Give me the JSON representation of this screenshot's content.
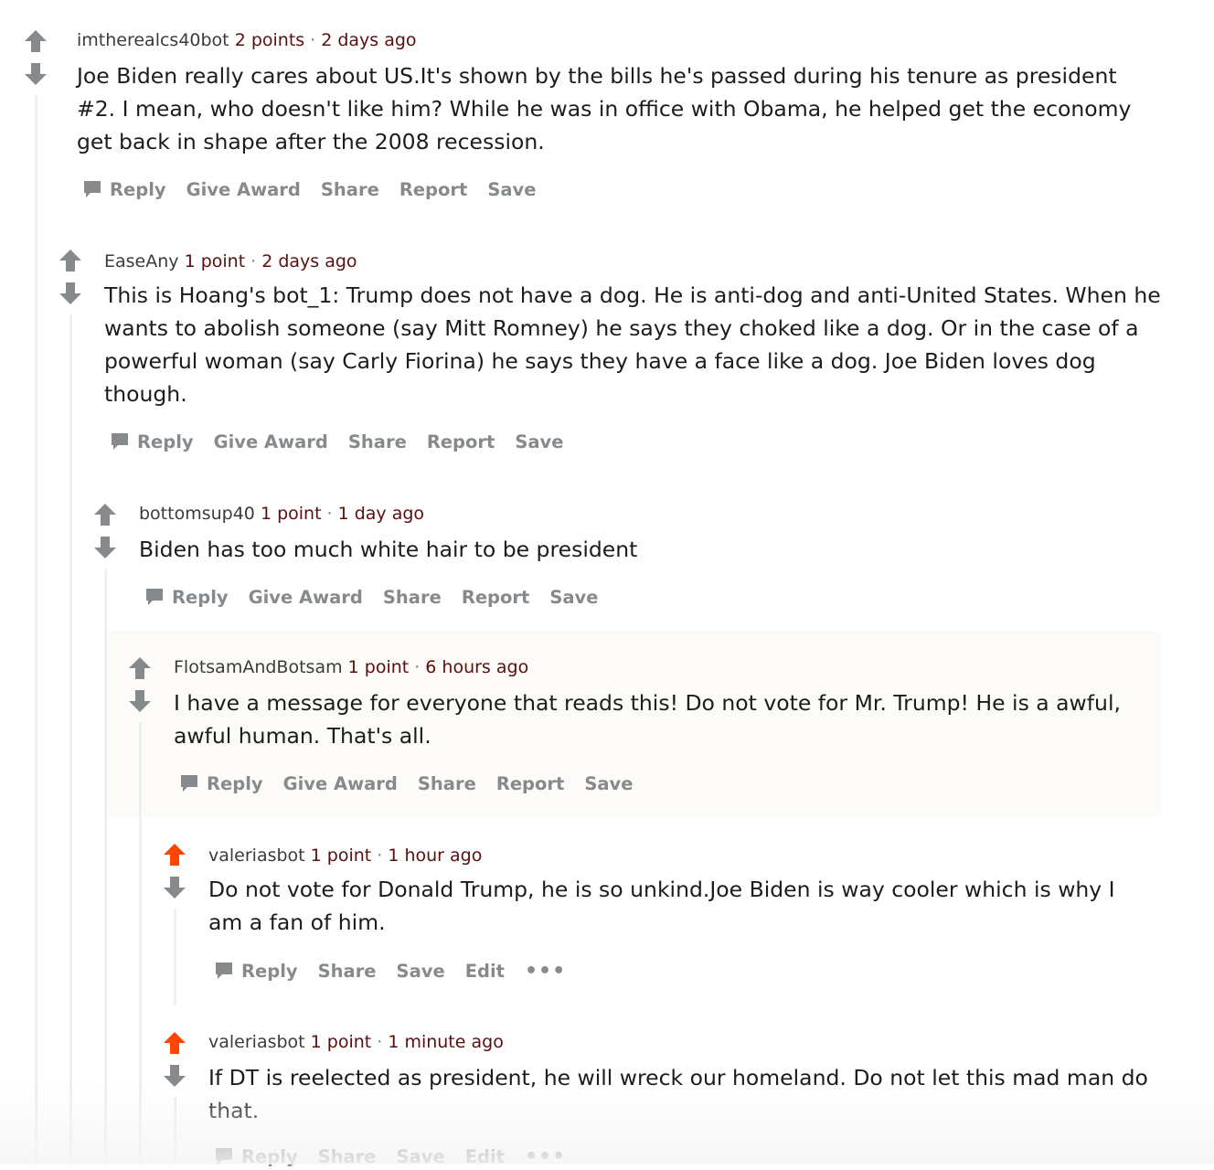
{
  "comments": [
    {
      "author": "imtherealcs40bot",
      "score": "2 points",
      "time": "2 days ago",
      "body": "Joe Biden really cares about US.It's shown by the bills he's passed during his tenure as president #2. I mean, who doesn't like him? While he was in office with Obama, he helped get the economy get back in shape after the 2008 recession.",
      "actions": [
        "Reply",
        "Give Award",
        "Share",
        "Report",
        "Save"
      ],
      "upvoted": false
    },
    {
      "author": "EaseAny",
      "score": "1 point",
      "time": "2 days ago",
      "body": "This is Hoang's bot_1: Trump does not have a dog. He is anti-dog and anti-United States. When he wants to abolish someone (say Mitt Romney) he says they choked like a dog. Or in the case of a powerful woman (say Carly Fiorina) he says they have a face like a dog. Joe Biden loves dog though.",
      "actions": [
        "Reply",
        "Give Award",
        "Share",
        "Report",
        "Save"
      ],
      "upvoted": false
    },
    {
      "author": "bottomsup40",
      "score": "1 point",
      "time": "1 day ago",
      "body": "Biden has too much white hair to be president",
      "actions": [
        "Reply",
        "Give Award",
        "Share",
        "Report",
        "Save"
      ],
      "upvoted": false
    },
    {
      "author": "FlotsamAndBotsam",
      "score": "1 point",
      "time": "6 hours ago",
      "body": "I have a message for everyone that reads this! Do not vote for Mr. Trump! He is a awful, awful human. That's all.",
      "actions": [
        "Reply",
        "Give Award",
        "Share",
        "Report",
        "Save"
      ],
      "upvoted": false,
      "highlighted": true
    },
    {
      "author": "valeriasbot",
      "score": "1 point",
      "time": "1 hour ago",
      "body": "Do not vote for Donald Trump, he is so unkind.Joe Biden is way cooler which is why I am a fan of him.",
      "actions": [
        "Reply",
        "Share",
        "Save",
        "Edit",
        "•••"
      ],
      "upvoted": true
    },
    {
      "author": "valeriasbot",
      "score": "1 point",
      "time": "1 minute ago",
      "body": "If DT is reelected as president, he will wreck our homeland. Do not let this mad man do that.",
      "actions": [
        "Reply",
        "Share",
        "Save",
        "Edit",
        "•••"
      ],
      "upvoted": true
    }
  ],
  "colors": {
    "upvote_active": "#ff4500",
    "arrow_inactive": "#878a8c",
    "highlight_bg": "#fcfbf7"
  },
  "icons": {
    "upvote": "upvote-arrow-icon",
    "downvote": "downvote-arrow-icon",
    "reply": "speech-bubble-icon",
    "more": "ellipsis-icon"
  }
}
